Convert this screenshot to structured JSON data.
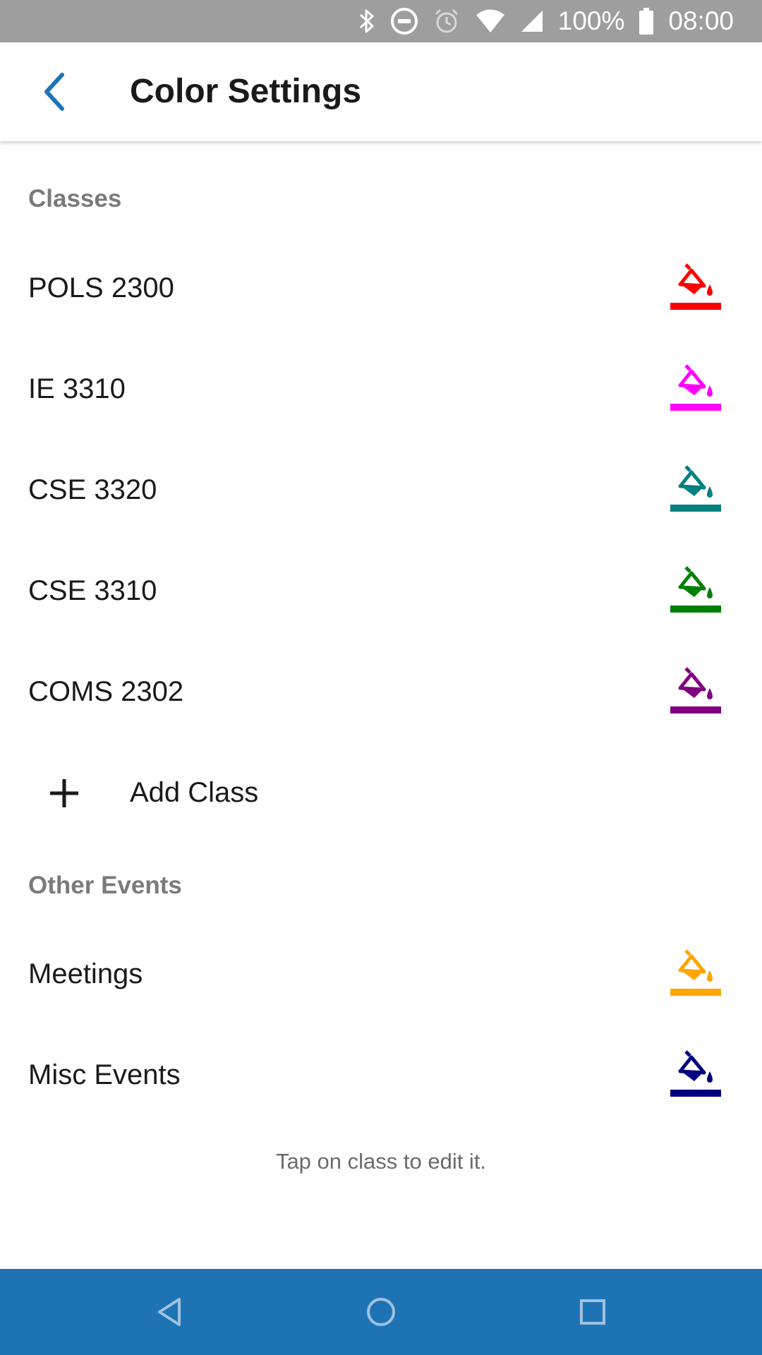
{
  "status_bar": {
    "battery_text": "100%",
    "time": "08:00",
    "icons": [
      "bluetooth-icon",
      "do-not-disturb-icon",
      "alarm-icon",
      "wifi-icon",
      "cell-signal-icon",
      "battery-icon"
    ]
  },
  "header": {
    "back_icon": "chevron-left-icon",
    "title": "Color Settings"
  },
  "sections": {
    "classes_header": "Classes",
    "classes": [
      {
        "label": "POLS 2300",
        "color": "#ff0000"
      },
      {
        "label": "IE 3310",
        "color": "#ff00ff"
      },
      {
        "label": "CSE 3320",
        "color": "#008080"
      },
      {
        "label": "CSE 3310",
        "color": "#008000"
      },
      {
        "label": "COMS 2302",
        "color": "#800080"
      }
    ],
    "add_class_label": "Add Class",
    "other_header": "Other Events",
    "other": [
      {
        "label": "Meetings",
        "color": "#ffa500"
      },
      {
        "label": "Misc Events",
        "color": "#000080"
      }
    ]
  },
  "hint": "Tap on class to edit it.",
  "nav": {
    "back": "nav-back-icon",
    "home": "nav-home-icon",
    "recents": "nav-recents-icon"
  },
  "colors": {
    "accent": "#1e73b5",
    "status_bar": "#9e9e9e"
  }
}
